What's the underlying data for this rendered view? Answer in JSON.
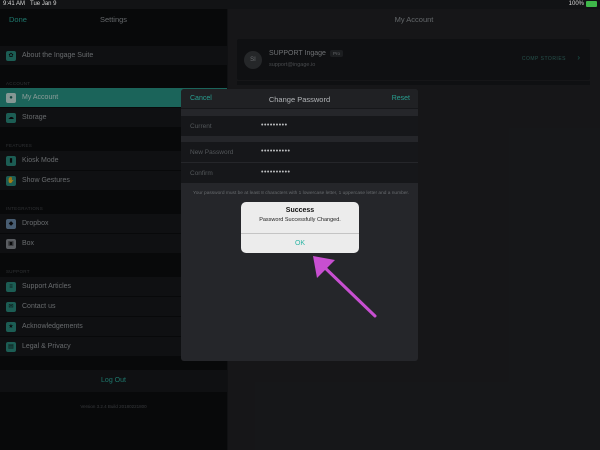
{
  "status_bar": {
    "time": "9:41 AM",
    "date": "Tue Jan 9",
    "battery_percent": "100%",
    "battery_icon": "battery-full-icon"
  },
  "left_pane": {
    "done_label": "Done",
    "title": "Settings",
    "items_top": [
      {
        "label": "About the Ingage Suite",
        "icon": "leaf-icon"
      }
    ],
    "sections": [
      {
        "header": "ACCOUNT",
        "items": [
          {
            "label": "My Account",
            "icon": "person-icon",
            "active": true
          },
          {
            "label": "Storage",
            "icon": "cloud-icon"
          }
        ]
      },
      {
        "header": "FEATURES",
        "items": [
          {
            "label": "Kiosk Mode",
            "icon": "kiosk-icon"
          },
          {
            "label": "Show Gestures",
            "icon": "hand-icon"
          }
        ]
      },
      {
        "header": "INTEGRATIONS",
        "items": [
          {
            "label": "Dropbox",
            "icon": "dropbox-icon"
          },
          {
            "label": "Box",
            "icon": "box-icon"
          }
        ]
      },
      {
        "header": "SUPPORT",
        "items": [
          {
            "label": "Support Articles",
            "icon": "article-icon"
          },
          {
            "label": "Contact us",
            "icon": "chat-icon"
          },
          {
            "label": "Acknowledgements",
            "icon": "star-icon"
          },
          {
            "label": "Legal & Privacy",
            "icon": "document-icon"
          }
        ]
      }
    ],
    "logout_label": "Log Out",
    "version": "Version 3.2.4 Build 20180221800"
  },
  "right_pane": {
    "title": "My Account",
    "account": {
      "avatar_initials": "SI",
      "name": "SUPPORT Ingage",
      "tier": "Pro",
      "email": "support@ingage.io",
      "comp_label": "COMP STORIES",
      "chevron": "chevron-right-icon"
    }
  },
  "change_password": {
    "cancel_label": "Cancel",
    "title": "Change Password",
    "reset_label": "Reset",
    "fields": [
      {
        "label": "Current",
        "value": "•••••••••"
      },
      {
        "label": "New Password",
        "value": "••••••••••"
      },
      {
        "label": "Confirm",
        "value": "••••••••••"
      }
    ],
    "hint": "Your password must be at least 8 characters with 1 lowercase letter, 1 uppercase letter and a number."
  },
  "alert": {
    "title": "Success",
    "message": "Password Successfully Changed.",
    "ok_label": "OK"
  },
  "annotation": {
    "color": "#c84fd1",
    "icon": "arrow-pointer-icon"
  },
  "colors": {
    "accent": "#2eb6a5",
    "active_row": "#2a9a8b",
    "background": "#101113"
  }
}
